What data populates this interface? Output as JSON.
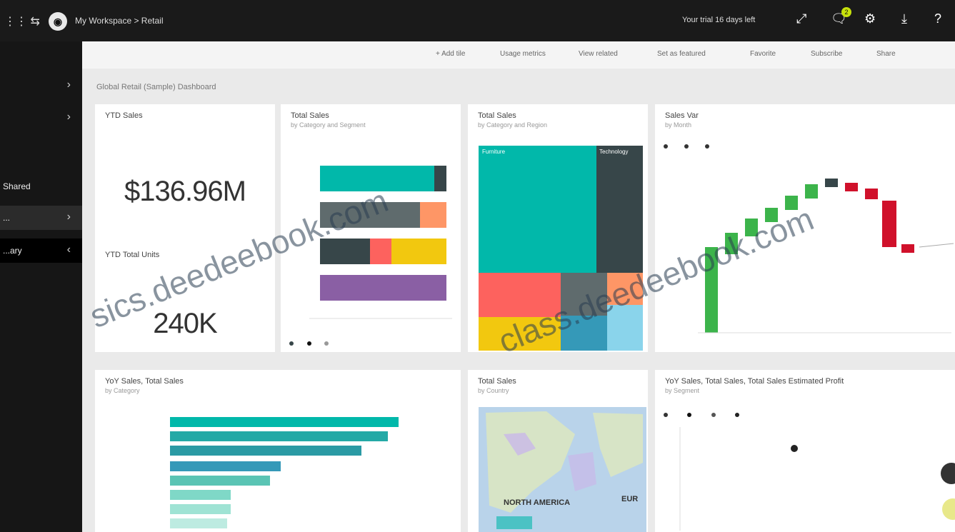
{
  "topbar": {
    "breadcrumb": "My Workspace > Retail",
    "notice": "Your trial 16 days left",
    "badge": "2",
    "icons": [
      "grid-icon",
      "logo-icon",
      "expand-icon",
      "notifications-icon",
      "settings-icon",
      "download-icon",
      "help-icon"
    ]
  },
  "nav": {
    "items": [
      {
        "label": "",
        "icon": "chevron-right-icon"
      },
      {
        "label": "",
        "icon": "chevron-right-icon"
      },
      {
        "label": "Shared",
        "icon": ""
      },
      {
        "label": "...",
        "icon": "chevron-right-icon"
      },
      {
        "label": "...ary",
        "icon": "chevron-left-icon"
      }
    ]
  },
  "actions": [
    {
      "label": "+ Add tile"
    },
    {
      "label": "Usage metrics"
    },
    {
      "label": "View related"
    },
    {
      "label": "Set as featured"
    },
    {
      "label": "Favorite"
    },
    {
      "label": "Subscribe"
    },
    {
      "label": "Share"
    }
  ],
  "dashboard": {
    "title": "Global Retail (Sample) Dashboard",
    "tiles": {
      "kpi": {
        "title": "YTD Sales",
        "value1": "$136.96M",
        "label2": "YTD Total Units",
        "value2": "240K"
      },
      "stacked": {
        "title": "Total Sales",
        "subtitle": "by Category and Segment"
      },
      "treemap": {
        "title": "Total Sales",
        "subtitle": "by Category and Region",
        "label_a": "Furniture",
        "label_b": "Technology"
      },
      "waterfall": {
        "title": "Sales Var",
        "subtitle": "by Month"
      },
      "bars": {
        "title": "YoY Sales, Total Sales",
        "subtitle": "by Category"
      },
      "map": {
        "title": "Total Sales",
        "subtitle": "by Country",
        "label_na": "NORTH AMERICA",
        "label_eu": "EUR"
      },
      "scatter": {
        "title": "YoY Sales, Total Sales, Total Sales Estimated Profit",
        "subtitle": "by Segment"
      }
    }
  },
  "colors": {
    "teal": "#01b8aa",
    "dark": "#374649",
    "red": "#fd625e",
    "yellow": "#f2c80f",
    "purple": "#8a5fa4",
    "green": "#3cb44b",
    "crimson": "#d0112b"
  },
  "watermark": {
    "text1": "sics.deedeebook.com",
    "text2": "class.deedeebook.com"
  }
}
